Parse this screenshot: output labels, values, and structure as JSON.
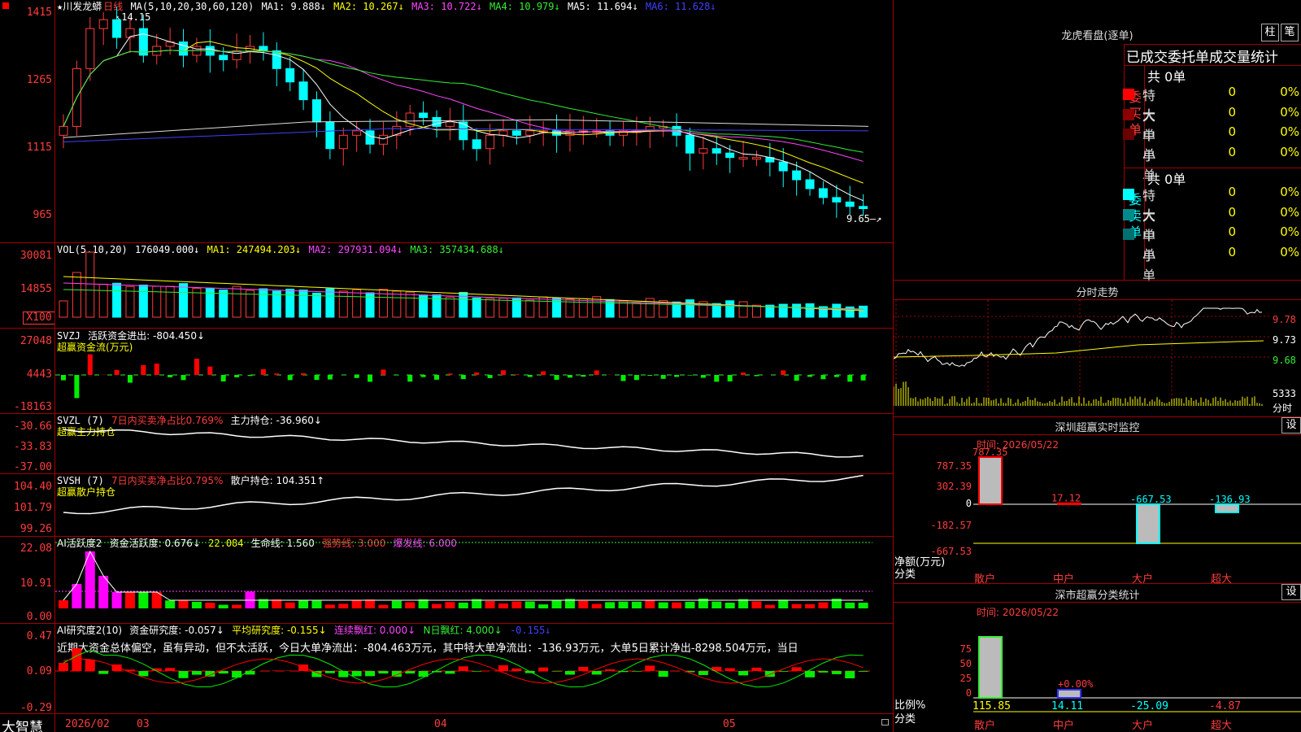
{
  "header": {
    "stock_name": "★川发龙蟒",
    "period": "日线",
    "ma_label": "MA(5,10,20,30,60,120)",
    "ma1": "MA1: 9.888↓",
    "ma2": "MA2: 10.267↓",
    "ma3": "MA3: 10.722↓",
    "ma4": "MA4: 10.979↓",
    "ma5": "MA5: 11.694↓",
    "ma6": "MA6: 11.628↓",
    "high_mark": "14.15",
    "low_mark": "9.65"
  },
  "price_axis": [
    "1415",
    "1265",
    "1115",
    "965"
  ],
  "vol": {
    "label": "VOL(5,10,20)",
    "value": "176049.000↓",
    "ma1": "MA1: 247494.203↓",
    "ma2": "MA2: 297931.094↓",
    "ma3": "MA3: 357434.688↓",
    "axis": [
      "30081",
      "14855",
      "X100"
    ]
  },
  "svzj": {
    "label": "SVZJ",
    "desc": "活跃资金进出: -804.450↓",
    "sub": "超赢资金流(万元)",
    "axis": [
      "27048",
      "4443",
      "-18163"
    ]
  },
  "svzl": {
    "label": "SVZL (7)",
    "desc1": "7日内买卖净占比0.769%",
    "desc2": "主力持仓: -36.960↓",
    "sub": "超赢主力持仓",
    "axis": [
      "-30.66",
      "-33.83",
      "-37.00"
    ]
  },
  "svsh": {
    "label": "SVSH (7)",
    "desc1": "7日内买卖净占比0.795%",
    "desc2": "散户持仓: 104.351↑",
    "sub": "超赢散户持仓",
    "axis": [
      "104.40",
      "101.79",
      "99.26"
    ]
  },
  "ai_active": {
    "label": "AI活跃度2",
    "v1": "资金活跃度: 0.676↓",
    "v2": "22.084",
    "v3": "生命线: 1.560",
    "v4": "强势线: 3.000",
    "v5": "爆发线: 6.000",
    "axis": [
      "22.08",
      "10.91",
      "0.00"
    ]
  },
  "ai_research": {
    "label": "AI研究度2(10)",
    "v1": "资金研究度: -0.057↓",
    "v2": "平均研究度: -0.155↓",
    "v3": "连续飘红: 0.000↓",
    "v4": "N日飘红: 4.000↓",
    "v5": "-0.155↓",
    "comment": "近期大资金总体偏空，虽有异动，但不太活跃，今日大单净流出：-804.463万元，其中特大单净流出：-136.93万元，大单5日累计净出-8298.504万元，当日",
    "axis": [
      "0.47",
      "0.09",
      "-0.29"
    ]
  },
  "date_axis": {
    "brand": "大智慧",
    "labels": [
      "2026/02",
      "03",
      "04",
      "05"
    ]
  },
  "dragon_tiger": {
    "title": "龙虎看盘(逐单)",
    "btn1": "柱",
    "btn2": "笔",
    "subtitle": "已成交委托单成交量统计",
    "buy_side": "委买单",
    "sell_side": "委卖单",
    "buy_total": "共 0单",
    "sell_total": "共 0单",
    "buy_rows": [
      {
        "label": "特大",
        "count": "0",
        "pct": "0%",
        "color": "#ff0000"
      },
      {
        "label": "大单",
        "count": "0",
        "pct": "0%",
        "color": "#8b0000"
      },
      {
        "label": "中单",
        "count": "0",
        "pct": "0%",
        "color": "#6a0000"
      },
      {
        "label": "小单",
        "count": "0",
        "pct": "0%",
        "color": ""
      }
    ],
    "sell_rows": [
      {
        "label": "特大",
        "count": "0",
        "pct": "0%",
        "color": "#00ffff"
      },
      {
        "label": "大单",
        "count": "0",
        "pct": "0%",
        "color": "#008b8b"
      },
      {
        "label": "中单",
        "count": "0",
        "pct": "0%",
        "color": "#007070"
      },
      {
        "label": "小单",
        "count": "0",
        "pct": "0%",
        "color": ""
      }
    ]
  },
  "intraday": {
    "title": "分时走势",
    "axis": [
      "9.78",
      "9.73",
      "9.68"
    ],
    "vol_axis": "5333",
    "vol_unit": "分时"
  },
  "sz_monitor": {
    "title": "深圳超赢实时监控",
    "btn": "设",
    "time": "时间: 2026/05/22",
    "axis": [
      "787.35",
      "302.39",
      "0",
      "-182.57",
      "-667.53"
    ],
    "unit": "净额(万元)",
    "cat_label": "分类",
    "categories": [
      "散户",
      "中户",
      "大户",
      "超大"
    ],
    "values": [
      "787.35",
      "17.12",
      "-667.53",
      "-136.93"
    ]
  },
  "sz_class": {
    "title": "深市超赢分类统计",
    "btn": "设",
    "time": "时间: 2026/05/22",
    "axis": [
      "75",
      "50",
      "25",
      "0"
    ],
    "unit": "比例%",
    "cat_label": "分类",
    "categories": [
      "散户",
      "中户",
      "大户",
      "超大"
    ],
    "values": [
      "115.85",
      "14.11",
      "-25.09",
      "-4.87"
    ],
    "bar_label": "+0.00%"
  }
}
